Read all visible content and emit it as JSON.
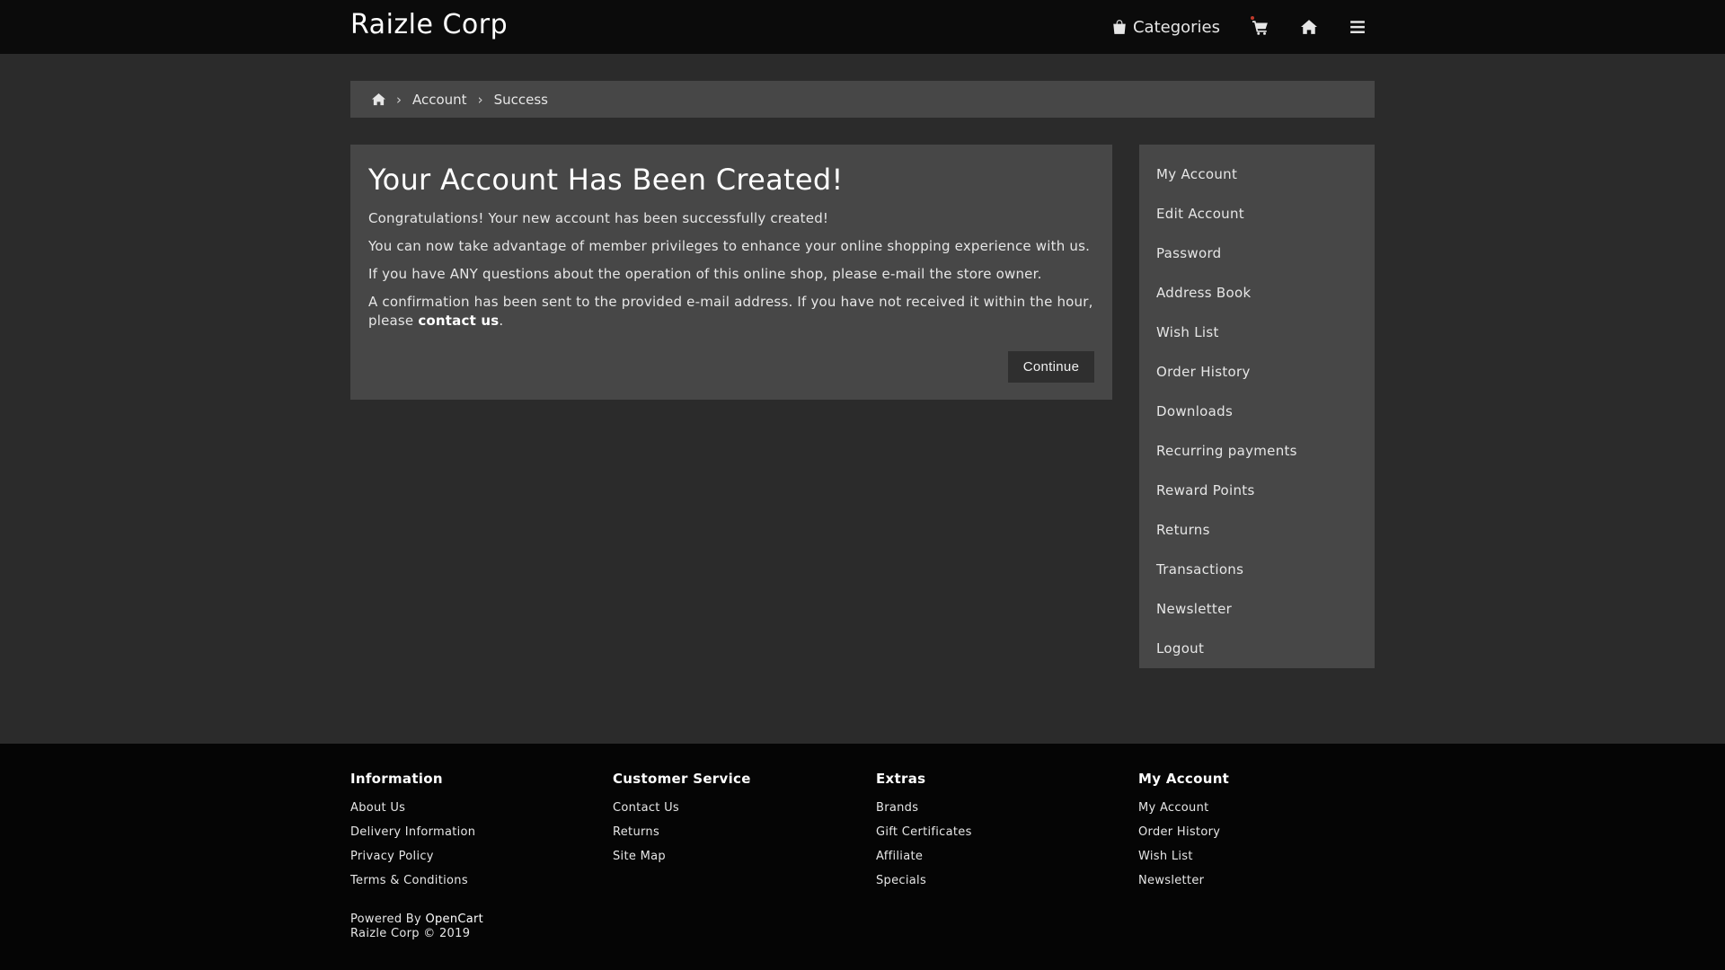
{
  "header": {
    "brand": "Raizle Corp",
    "categories_label": "Categories",
    "icons": [
      "shopping-bag-icon",
      "cart-icon",
      "home-icon",
      "menu-icon"
    ]
  },
  "breadcrumb": {
    "items": [
      "Account",
      "Success"
    ]
  },
  "main": {
    "title": "Your Account Has Been Created!",
    "paragraphs": [
      "Congratulations! Your new account has been successfully created!",
      "You can now take advantage of member privileges to enhance your online shopping experience with us.",
      "If you have ANY questions about the operation of this online shop, please e-mail the store owner."
    ],
    "confirm_text_before": "A confirmation has been sent to the provided e-mail address. If you have not received it within the hour, please ",
    "confirm_link": "contact us",
    "confirm_text_after": ".",
    "continue_label": "Continue"
  },
  "sidebar": {
    "items": [
      "My Account",
      "Edit Account",
      "Password",
      "Address Book",
      "Wish List",
      "Order History",
      "Downloads",
      "Recurring payments",
      "Reward Points",
      "Returns",
      "Transactions",
      "Newsletter",
      "Logout"
    ]
  },
  "footer": {
    "columns": [
      {
        "title": "Information",
        "links": [
          "About Us",
          "Delivery Information",
          "Privacy Policy",
          "Terms & Conditions"
        ]
      },
      {
        "title": "Customer Service",
        "links": [
          "Contact Us",
          "Returns",
          "Site Map"
        ]
      },
      {
        "title": "Extras",
        "links": [
          "Brands",
          "Gift Certificates",
          "Affiliate",
          "Specials"
        ]
      },
      {
        "title": "My Account",
        "links": [
          "My Account",
          "Order History",
          "Wish List",
          "Newsletter"
        ]
      }
    ],
    "powered_prefix": "Powered By ",
    "powered_link": "OpenCart",
    "copyright": "Raizle Corp © 2019"
  },
  "colors": {
    "header_bg": "#0b0b0b",
    "page_bg": "#2b2b2b",
    "panel_bg": "#474747",
    "footer_bg": "#050505",
    "button_bg": "#2f2f2f",
    "cart_dot": "#c0392b"
  }
}
